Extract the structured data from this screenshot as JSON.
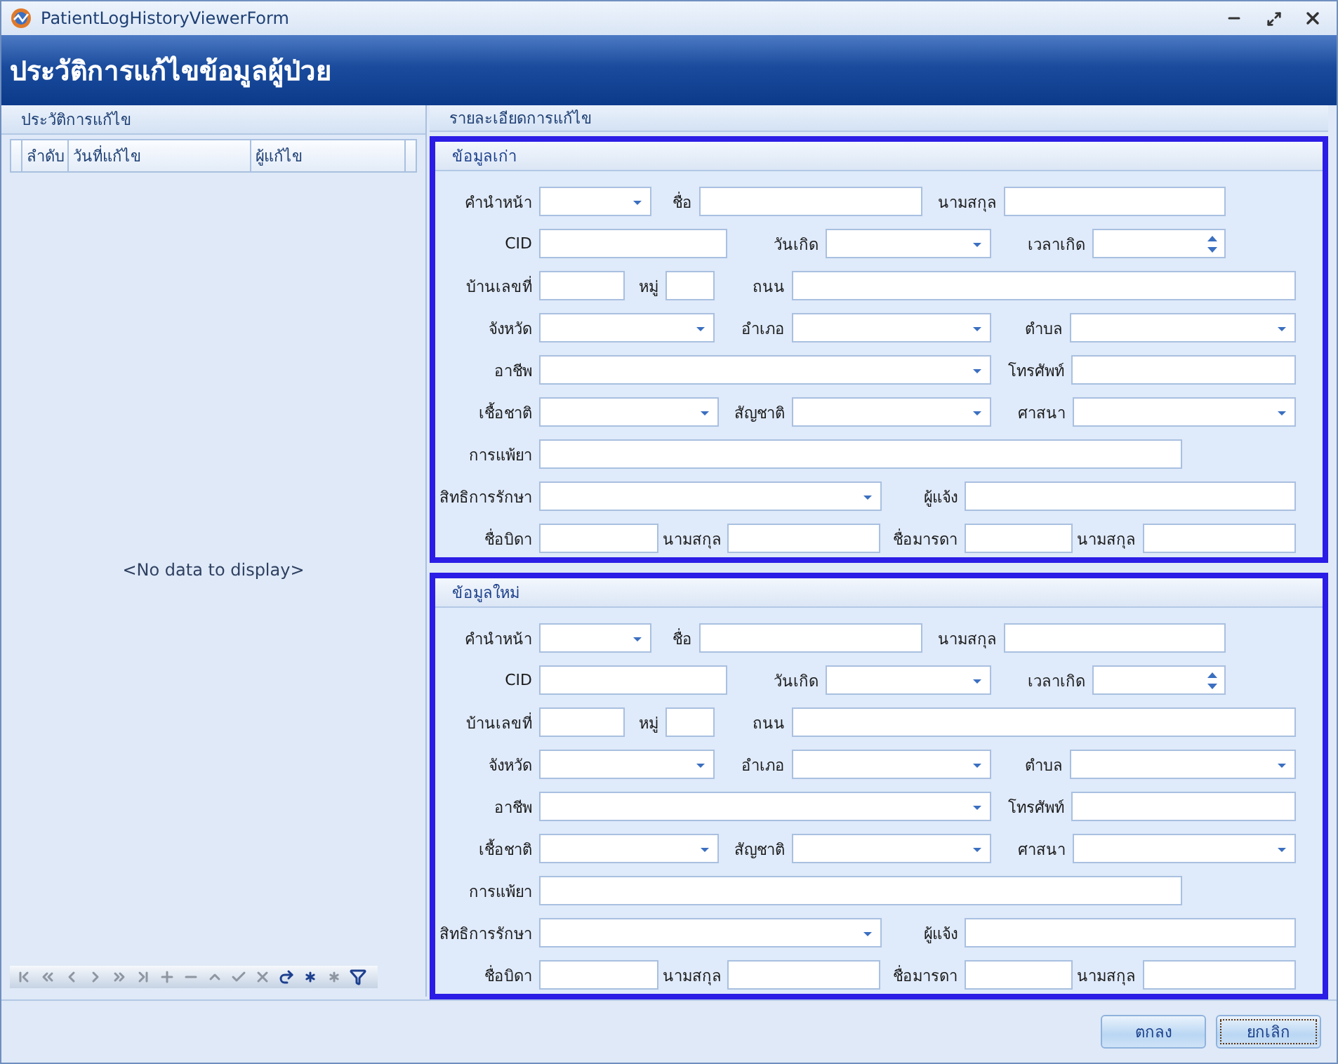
{
  "window": {
    "title": "PatientLogHistoryViewerForm"
  },
  "header": {
    "title": "ประวัติการแก้ไขข้อมูลผู้ป่วย"
  },
  "history": {
    "title": "ประวัติการแก้ไข",
    "columns": [
      "ลำดับ",
      "วันที่แก้ไข",
      "ผู้แก้ไข"
    ],
    "empty_text": "<No data to display>",
    "navigator": [
      {
        "kind": "first",
        "disabled": true
      },
      {
        "kind": "prev-page",
        "disabled": true
      },
      {
        "kind": "prev",
        "disabled": true
      },
      {
        "kind": "next",
        "disabled": true
      },
      {
        "kind": "next-page",
        "disabled": true
      },
      {
        "kind": "last",
        "disabled": true
      },
      {
        "kind": "append",
        "disabled": true
      },
      {
        "kind": "remove",
        "disabled": true
      },
      {
        "kind": "edit",
        "disabled": true
      },
      {
        "kind": "end-edit",
        "disabled": true
      },
      {
        "kind": "cancel-edit",
        "disabled": true
      },
      {
        "kind": "refresh",
        "disabled": false
      },
      {
        "kind": "save-bookmark",
        "disabled": false
      },
      {
        "kind": "goto-bookmark",
        "disabled": true
      },
      {
        "kind": "filter",
        "disabled": false
      }
    ]
  },
  "details": {
    "title": "รายละเอียดการแก้ไข",
    "groups": [
      {
        "title": "ข้อมูลเก่า",
        "rows": [
          [
            {
              "label": "คำนำหน้า",
              "kind": "combo"
            },
            {
              "label": "ชื่อ",
              "kind": "text"
            },
            {
              "label": "นามสกุล",
              "kind": "text"
            }
          ],
          [
            {
              "label": "CID",
              "kind": "text"
            },
            {
              "label": "วันเกิด",
              "kind": "combo"
            },
            {
              "label": "เวลาเกิด",
              "kind": "spin"
            }
          ],
          [
            {
              "label": "บ้านเลขที่",
              "kind": "text"
            },
            {
              "label": "หมู่",
              "kind": "text"
            },
            {
              "label": "ถนน",
              "kind": "text"
            }
          ],
          [
            {
              "label": "จังหวัด",
              "kind": "combo"
            },
            {
              "label": "อำเภอ",
              "kind": "combo"
            },
            {
              "label": "ตำบล",
              "kind": "combo"
            }
          ],
          [
            {
              "label": "อาชีพ",
              "kind": "combo"
            },
            {
              "label": "โทรศัพท์",
              "kind": "text"
            }
          ],
          [
            {
              "label": "เชื้อชาติ",
              "kind": "combo"
            },
            {
              "label": "สัญชาติ",
              "kind": "combo"
            },
            {
              "label": "ศาสนา",
              "kind": "combo"
            }
          ],
          [
            {
              "label": "การแพ้ยา",
              "kind": "text"
            }
          ],
          [
            {
              "label": "สิทธิการรักษา",
              "kind": "combo"
            },
            {
              "label": "ผู้แจ้ง",
              "kind": "text"
            }
          ],
          [
            {
              "label": "ชื่อบิดา",
              "kind": "text"
            },
            {
              "label": "นามสกุล",
              "kind": "text"
            },
            {
              "label": "ชื่อมารดา",
              "kind": "text"
            },
            {
              "label": "นามสกุล",
              "kind": "text"
            }
          ]
        ]
      },
      {
        "title": "ข้อมูลใหม่",
        "rows": [
          [
            {
              "label": "คำนำหน้า",
              "kind": "combo"
            },
            {
              "label": "ชื่อ",
              "kind": "text"
            },
            {
              "label": "นามสกุล",
              "kind": "text"
            }
          ],
          [
            {
              "label": "CID",
              "kind": "text"
            },
            {
              "label": "วันเกิด",
              "kind": "combo"
            },
            {
              "label": "เวลาเกิด",
              "kind": "spin"
            }
          ],
          [
            {
              "label": "บ้านเลขที่",
              "kind": "text"
            },
            {
              "label": "หมู่",
              "kind": "text"
            },
            {
              "label": "ถนน",
              "kind": "text"
            }
          ],
          [
            {
              "label": "จังหวัด",
              "kind": "combo"
            },
            {
              "label": "อำเภอ",
              "kind": "combo"
            },
            {
              "label": "ตำบล",
              "kind": "combo"
            }
          ],
          [
            {
              "label": "อาชีพ",
              "kind": "combo"
            },
            {
              "label": "โทรศัพท์",
              "kind": "text"
            }
          ],
          [
            {
              "label": "เชื้อชาติ",
              "kind": "combo"
            },
            {
              "label": "สัญชาติ",
              "kind": "combo"
            },
            {
              "label": "ศาสนา",
              "kind": "combo"
            }
          ],
          [
            {
              "label": "การแพ้ยา",
              "kind": "text"
            }
          ],
          [
            {
              "label": "สิทธิการรักษา",
              "kind": "combo"
            },
            {
              "label": "ผู้แจ้ง",
              "kind": "text"
            }
          ],
          [
            {
              "label": "ชื่อบิดา",
              "kind": "text"
            },
            {
              "label": "นามสกุล",
              "kind": "text"
            },
            {
              "label": "ชื่อมารดา",
              "kind": "text"
            },
            {
              "label": "นามสกุล",
              "kind": "text"
            }
          ]
        ]
      }
    ]
  },
  "buttons": [
    {
      "label": "ตกลง",
      "focused": false
    },
    {
      "label": "ยกเลิก",
      "focused": true
    }
  ]
}
